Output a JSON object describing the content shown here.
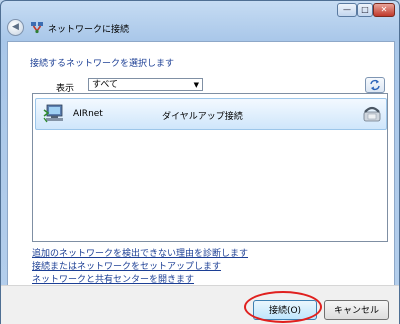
{
  "window": {
    "title": "ネットワークに接続",
    "controls": {
      "minimize": "—",
      "maximize": "□",
      "close": "✕"
    }
  },
  "header": {
    "instruction": "接続するネットワークを選択します"
  },
  "filter": {
    "label": "表示",
    "selected": "すべて"
  },
  "networks": [
    {
      "name": "AIRnet",
      "type": "ダイヤルアップ接続",
      "icon": "dialup-computer-icon"
    }
  ],
  "links": [
    "追加のネットワークを検出できない理由を診断します",
    "接続またはネットワークをセットアップします",
    "ネットワークと共有センターを開きます"
  ],
  "buttons": {
    "connect": "接続(O)",
    "cancel": "キャンセル"
  },
  "colors": {
    "link": "#1c3f95",
    "highlight_ring": "#e0201e",
    "selected_row": "#cfe6fb"
  }
}
